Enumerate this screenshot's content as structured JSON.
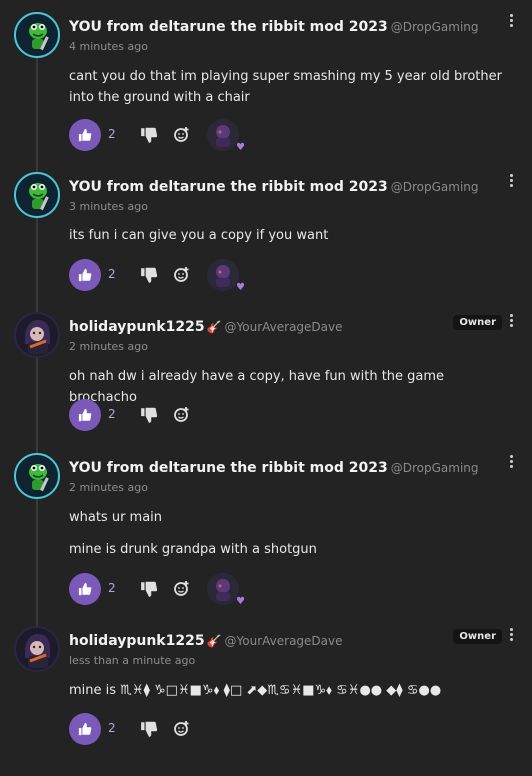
{
  "comments": [
    {
      "username": "YOU from deltarune the ribbit mod 2023",
      "handle": "@DropGaming",
      "time": "4 minutes ago",
      "lines": [
        "cant you do that im playing super smashing my 5 year old brother into the ground with a chair"
      ],
      "likes": "2",
      "avatar": "frog-avatar",
      "owner": "",
      "has_reactor": true
    },
    {
      "username": "YOU from deltarune the ribbit mod 2023",
      "handle": "@DropGaming",
      "time": "3 minutes ago",
      "lines": [
        "its fun i can give you a copy if you want"
      ],
      "likes": "2",
      "avatar": "frog-avatar",
      "owner": "",
      "has_reactor": true
    },
    {
      "username": "holidaypunk1225",
      "handle": "@YourAverageDave",
      "time": "2 minutes ago",
      "lines": [
        "oh nah dw i already have a copy, have fun with the game brochacho"
      ],
      "likes": "2",
      "avatar": "punk-avatar",
      "owner": "Owner",
      "has_reactor": false
    },
    {
      "username": "YOU from deltarune the ribbit mod 2023",
      "handle": "@DropGaming",
      "time": "2 minutes ago",
      "lines": [
        "whats ur main",
        "mine is drunk grandpa with a shotgun"
      ],
      "likes": "2",
      "avatar": "frog-avatar",
      "owner": "",
      "has_reactor": true
    },
    {
      "username": "holidaypunk1225",
      "handle": "@YourAverageDave",
      "time": "less than a minute ago",
      "lines": [
        "mine is ♏︎♓︎⧫︎ ♑︎□︎♓︎■︎♑︎⬧︎ ⧫︎□︎ ⬈︎◆︎♏︎♋︎♓︎■︎♑︎⬧︎ ♋︎♓︎●︎● ◆︎⧫︎ ♋︎●︎●"
      ],
      "likes": "2",
      "avatar": "punk-avatar",
      "owner": "Owner",
      "has_reactor": false
    }
  ],
  "colors": {
    "accent": "#7b59b8",
    "background": "#232323",
    "frog_ring": "#49c7d8"
  },
  "icons": {
    "like": "thumbs-up-icon",
    "dislike": "thumbs-down-icon",
    "react": "add-reaction-icon",
    "menu": "kebab-menu-icon",
    "guitar": "guitar-emoji"
  }
}
